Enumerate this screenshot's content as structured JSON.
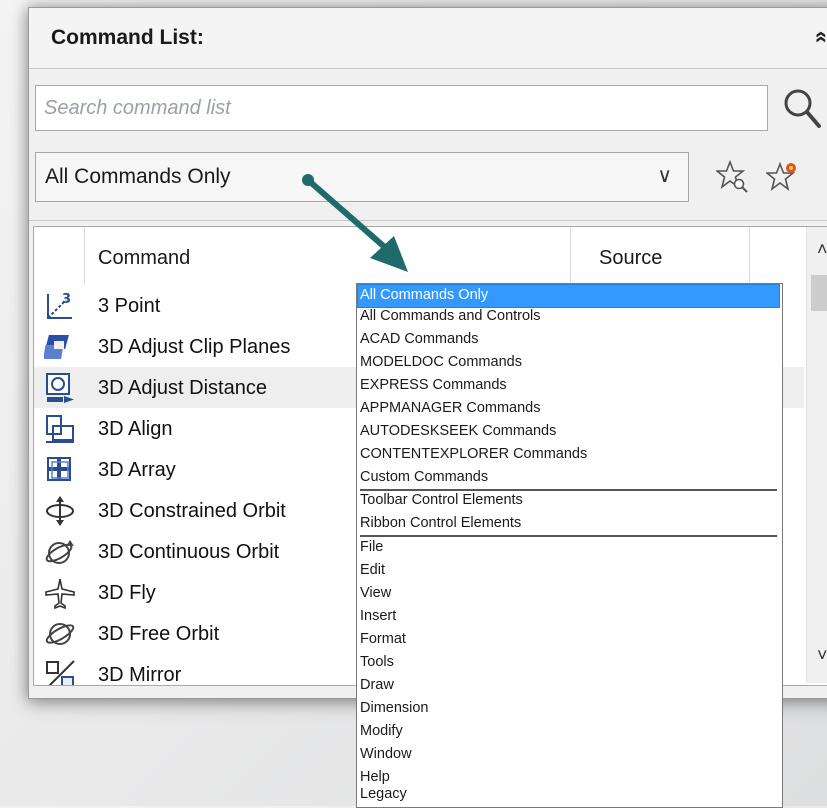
{
  "panel": {
    "title": "Command List:",
    "collapse_glyph": "«"
  },
  "search": {
    "placeholder": "Search command list"
  },
  "filter": {
    "selected": "All Commands Only",
    "arrow_glyph": "∨"
  },
  "table": {
    "columns": [
      "Command",
      "Source"
    ],
    "rows": [
      {
        "label": "3 Point",
        "icon": "3-point-icon"
      },
      {
        "label": "3D Adjust Clip Planes",
        "icon": "clip-planes-icon"
      },
      {
        "label": "3D Adjust Distance",
        "icon": "adjust-distance-icon"
      },
      {
        "label": "3D Align",
        "icon": "3d-align-icon"
      },
      {
        "label": "3D Array",
        "icon": "3d-array-icon"
      },
      {
        "label": "3D Constrained Orbit",
        "icon": "constrained-orbit-icon"
      },
      {
        "label": "3D Continuous Orbit",
        "icon": "continuous-orbit-icon"
      },
      {
        "label": "3D Fly",
        "icon": "3d-fly-icon"
      },
      {
        "label": "3D Free Orbit",
        "icon": "free-orbit-icon"
      },
      {
        "label": "3D Mirror",
        "icon": "3d-mirror-icon"
      }
    ],
    "highlighted_row": "3D Adjust Distance"
  },
  "scrollbar": {
    "up_glyph": "˄",
    "down_glyph": "˅"
  },
  "dropdown": {
    "options": [
      "All Commands Only",
      "All Commands and Controls",
      "ACAD Commands",
      "MODELDOC Commands",
      "EXPRESS Commands",
      "APPMANAGER Commands",
      "AUTODESKSEEK Commands",
      "CONTENTEXPLORER Commands",
      "Custom Commands",
      "Toolbar Control Elements",
      "Ribbon Control Elements",
      "File",
      "Edit",
      "View",
      "Insert",
      "Format",
      "Tools",
      "Draw",
      "Dimension",
      "Modify",
      "Window",
      "Help",
      "Legacy"
    ],
    "selected": "All Commands Only"
  },
  "colors": {
    "selection": "#3399ff",
    "arrow": "#1f6b6b",
    "favorite_star_accent": "#e8501e"
  }
}
